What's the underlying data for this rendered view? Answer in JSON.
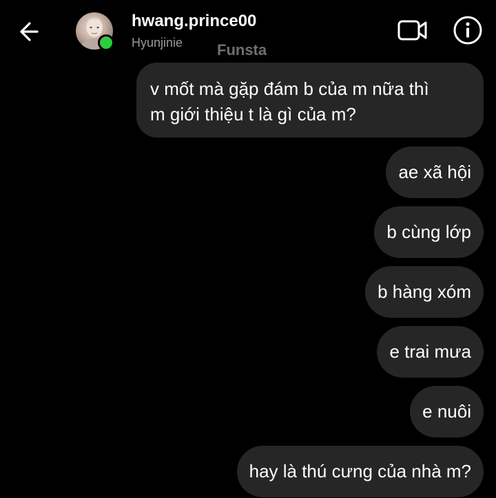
{
  "header": {
    "username": "hwang.prince00",
    "display_name": "Hyunjinie",
    "watermark": "Funsta",
    "back_icon": "arrow-left-icon",
    "video_icon": "video-camera-icon",
    "info_icon": "info-icon",
    "online_color": "#2ecc40"
  },
  "messages": [
    {
      "lines": [
        "v mốt mà gặp đám b của m nữa thì",
        "m giới thiệu t là gì của m?"
      ]
    },
    {
      "text": "ae xã hội"
    },
    {
      "text": "b cùng lớp"
    },
    {
      "text": "b hàng xóm"
    },
    {
      "text": "e trai mưa"
    },
    {
      "text": "e nuôi"
    },
    {
      "text": "hay là thú cưng của nhà m?"
    }
  ],
  "colors": {
    "background": "#000000",
    "bubble": "#262626",
    "text": "#ffffff",
    "secondary_text": "#9a9a9a"
  }
}
